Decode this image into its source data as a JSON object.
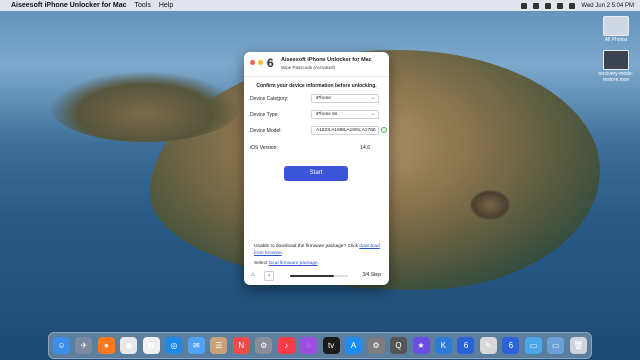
{
  "menubar": {
    "apple": "",
    "app_name": "Aiseesoft iPhone Unlocker for Mac",
    "items": [
      "Tools",
      "Help"
    ],
    "clock": "Wed Jun 2  5:04 PM"
  },
  "desktop": {
    "icons": [
      {
        "label": "All Photos"
      },
      {
        "label": "recovery-mode-restore.mov"
      }
    ]
  },
  "window": {
    "logo_glyph": "6",
    "title": "Aiseesoft iPhone Unlocker for Mac",
    "subtitle": "Wipe Passcode  (Activated)",
    "heading": "Confirm your device information before unlocking.",
    "fields": [
      {
        "label": "Device Category:",
        "value": "iPhone"
      },
      {
        "label": "Device Type:",
        "value": "iPhone 6s"
      },
      {
        "label": "Device Model:",
        "value": "A1633,A1688,A1691,A1700"
      }
    ],
    "ios_label": "iOS Version:",
    "ios_value": "14.6",
    "start_label": "Start",
    "download_note": "Unable to download the firmware package? Click ",
    "download_link": "download from browser",
    "download_end": ".",
    "select_note": "Select ",
    "select_link": "local firmware package",
    "select_end": ".",
    "step": "3/4 Step",
    "progress": 0.75,
    "home_icon": "⌂",
    "back_icon": "‹",
    "chevron": "⌄",
    "help": "?"
  },
  "dock": {
    "apps": [
      {
        "name": "finder-icon",
        "color": "#3d8ee8",
        "glyph": "☺"
      },
      {
        "name": "launchpad-icon",
        "color": "#7a8aa0",
        "glyph": "✈"
      },
      {
        "name": "firefox-icon",
        "color": "#ff7a1a",
        "glyph": "●"
      },
      {
        "name": "chrome-icon",
        "color": "#e8e8e8",
        "glyph": "◉"
      },
      {
        "name": "photos-icon",
        "color": "#f0f0f0",
        "glyph": "✿"
      },
      {
        "name": "safari-icon",
        "color": "#1e88e5",
        "glyph": "◎"
      },
      {
        "name": "mail-icon",
        "color": "#4fa3f7",
        "glyph": "✉"
      },
      {
        "name": "contacts-icon",
        "color": "#c9a27a",
        "glyph": "☰"
      },
      {
        "name": "news-icon",
        "color": "#f04b4b",
        "glyph": "N"
      },
      {
        "name": "settings-app-icon",
        "color": "#8a8f99",
        "glyph": "⚙"
      },
      {
        "name": "music-icon",
        "color": "#fc3c44",
        "glyph": "♪"
      },
      {
        "name": "podcasts-icon",
        "color": "#9b4de0",
        "glyph": "◌"
      },
      {
        "name": "tv-icon",
        "color": "#1b1b1b",
        "glyph": "tv"
      },
      {
        "name": "appstore-icon",
        "color": "#1c8cf0",
        "glyph": "A"
      },
      {
        "name": "system-prefs-icon",
        "color": "#7d7d7d",
        "glyph": "⚙"
      },
      {
        "name": "quicktime-icon",
        "color": "#555",
        "glyph": "Q"
      },
      {
        "name": "imovie-icon",
        "color": "#6b4de0",
        "glyph": "★"
      },
      {
        "name": "keynote-icon",
        "color": "#2d7bd8",
        "glyph": "K"
      },
      {
        "name": "unlocker-icon",
        "color": "#2a62d8",
        "glyph": "6"
      },
      {
        "name": "textedit-icon",
        "color": "#d8d8d8",
        "glyph": "✎"
      },
      {
        "name": "unlocker2-icon",
        "color": "#2a62d8",
        "glyph": "6"
      },
      {
        "name": "folder-icon",
        "color": "#4aa8e8",
        "glyph": "▭"
      },
      {
        "name": "downloads-icon",
        "color": "#6aa0d8",
        "glyph": "▭"
      },
      {
        "name": "trash-icon",
        "color": "#cfd4da",
        "glyph": "🗑"
      }
    ]
  }
}
